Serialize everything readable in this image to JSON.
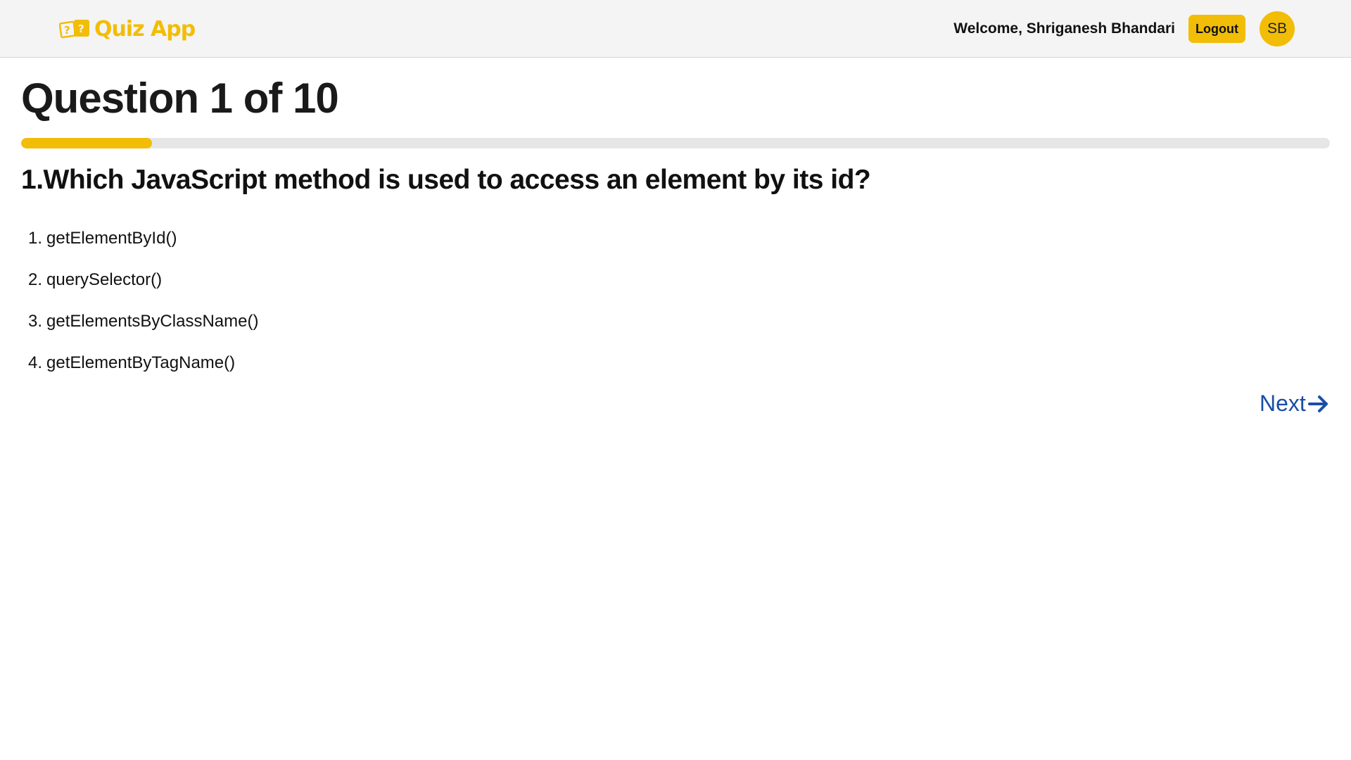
{
  "header": {
    "logo_text": "Quiz App",
    "logo_icon": "question-cards-icon",
    "welcome_text": "Welcome, Shriganesh Bhandari",
    "logout_label": "Logout",
    "avatar_initials": "SB"
  },
  "quiz": {
    "heading": "Question 1 of 10",
    "progress_fraction": 0.1,
    "question_text": "1.Which JavaScript method is used to access an element by its id?",
    "options": [
      {
        "number": "1.",
        "label": "getElementById()"
      },
      {
        "number": "2.",
        "label": "querySelector()"
      },
      {
        "number": "3.",
        "label": "getElementsByClassName()"
      },
      {
        "number": "4.",
        "label": "getElementByTagName()"
      }
    ],
    "next_label": "Next",
    "next_icon": "arrow-right-icon"
  },
  "colors": {
    "accent": "#f2bd07",
    "link": "#1a4fa3",
    "header_bg": "#f4f4f4",
    "progress_track": "#e6e6e6"
  }
}
